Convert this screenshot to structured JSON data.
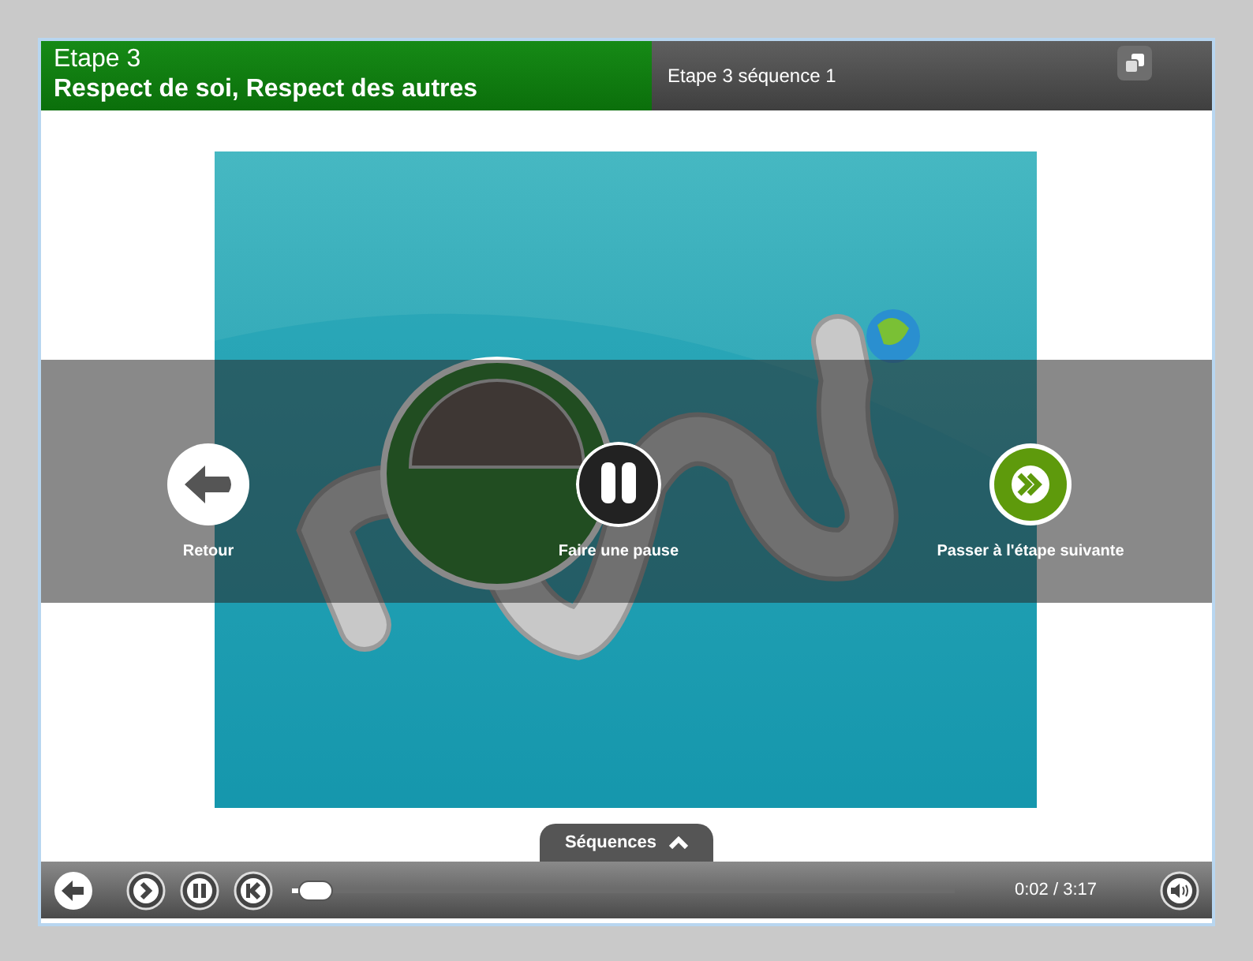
{
  "header": {
    "step": "Etape 3",
    "title": "Respect de soi, Respect des autres",
    "sequence": "Etape 3 séquence 1"
  },
  "overlay": [
    {
      "kind": "back",
      "label": "Retour"
    },
    {
      "kind": "pause",
      "label": "Faire une pause"
    },
    {
      "kind": "next",
      "label": "Passer à l'étape suivante"
    }
  ],
  "sequences_tab": {
    "label": "Séquences"
  },
  "controls": {
    "progress": {
      "level": 0.01
    },
    "time": "0:02 / 3:17"
  }
}
